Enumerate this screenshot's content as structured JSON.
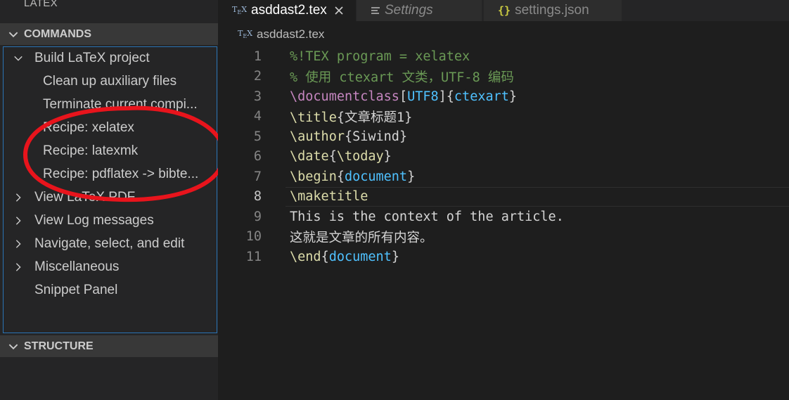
{
  "sidebar": {
    "title": "LATEX",
    "commands_header": "COMMANDS",
    "structure_header": "STRUCTURE",
    "items": [
      {
        "label": "Build LaTeX project",
        "expanded": true
      },
      {
        "label": "Clean up auxiliary files"
      },
      {
        "label": "Terminate current compi..."
      },
      {
        "label": "Recipe: xelatex"
      },
      {
        "label": "Recipe: latexmk"
      },
      {
        "label": "Recipe: pdflatex -> bibte..."
      },
      {
        "label": "View LaTeX PDF",
        "expanded": false
      },
      {
        "label": "View Log messages",
        "expanded": false
      },
      {
        "label": "Navigate, select, and edit",
        "expanded": false
      },
      {
        "label": "Miscellaneous",
        "expanded": false
      },
      {
        "label": "Snippet Panel"
      }
    ]
  },
  "tabs": [
    {
      "label": "asddast2.tex",
      "icon": "tex-icon",
      "active": true
    },
    {
      "label": "Settings",
      "icon": "settings-lines-icon",
      "active": false
    },
    {
      "label": "settings.json",
      "icon": "json-braces-icon",
      "active": false
    }
  ],
  "breadcrumb": {
    "file": "asddast2.tex"
  },
  "editor": {
    "current_line": 8,
    "lines": [
      {
        "n": "1",
        "parts": [
          [
            "c-comment",
            "%!TEX program = xelatex"
          ]
        ]
      },
      {
        "n": "2",
        "parts": [
          [
            "c-comment",
            "% 使用 ctexart 文类，UTF-8 编码"
          ]
        ]
      },
      {
        "n": "3",
        "parts": [
          [
            "c-kw",
            "\\documentclass"
          ],
          [
            "c-brace",
            "["
          ],
          [
            "c-arg",
            "UTF8"
          ],
          [
            "c-brace",
            "]{"
          ],
          [
            "c-arg",
            "ctexart"
          ],
          [
            "c-brace",
            "}"
          ]
        ]
      },
      {
        "n": "4",
        "parts": [
          [
            "c-fn",
            "\\title"
          ],
          [
            "c-brace",
            "{"
          ],
          [
            "c-text",
            "文章标题1"
          ],
          [
            "c-brace",
            "}"
          ]
        ]
      },
      {
        "n": "5",
        "parts": [
          [
            "c-fn",
            "\\author"
          ],
          [
            "c-brace",
            "{"
          ],
          [
            "c-text",
            "Siwind"
          ],
          [
            "c-brace",
            "}"
          ]
        ]
      },
      {
        "n": "6",
        "parts": [
          [
            "c-fn",
            "\\date"
          ],
          [
            "c-brace",
            "{"
          ],
          [
            "c-fn",
            "\\today"
          ],
          [
            "c-brace",
            "}"
          ]
        ]
      },
      {
        "n": "7",
        "parts": [
          [
            "c-fn",
            "\\begin"
          ],
          [
            "c-brace",
            "{"
          ],
          [
            "c-arg",
            "document"
          ],
          [
            "c-brace",
            "}"
          ]
        ]
      },
      {
        "n": "8",
        "parts": [
          [
            "c-fn",
            "\\maketitle"
          ]
        ]
      },
      {
        "n": "9",
        "parts": [
          [
            "c-text",
            "This is the context of the article."
          ]
        ]
      },
      {
        "n": "10",
        "parts": [
          [
            "c-text",
            "这就是文章的所有内容。"
          ]
        ]
      },
      {
        "n": "11",
        "parts": [
          [
            "c-fn",
            "\\end"
          ],
          [
            "c-brace",
            "{"
          ],
          [
            "c-arg",
            "document"
          ],
          [
            "c-brace",
            "}"
          ]
        ]
      }
    ]
  },
  "colors": {
    "annotation_circle": "#e8141c",
    "panel_focus_border": "#2a74b5"
  }
}
